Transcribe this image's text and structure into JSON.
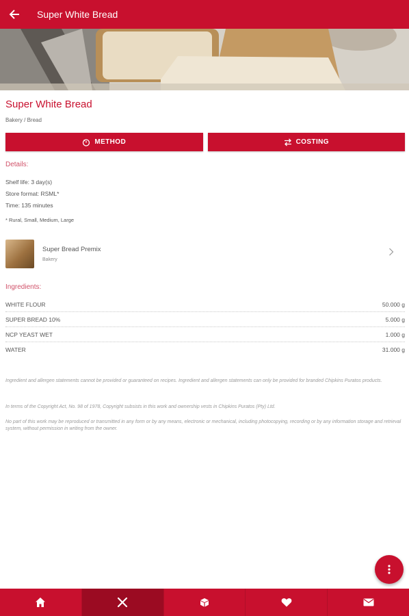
{
  "app_bar": {
    "title": "Super White Bread",
    "back_icon": "arrow-left-icon"
  },
  "recipe": {
    "title": "Super White Bread",
    "category": "Bakery / Bread"
  },
  "actions": {
    "method_label": "METHOD",
    "method_icon": "timer-icon",
    "costing_label": "COSTING",
    "costing_icon": "swap-arrows-icon"
  },
  "details": {
    "label": "Details:",
    "shelf_life": "Shelf life: 3 day(s)",
    "store_format": "Store format: RSML*",
    "time": "Time: 135 minutes",
    "footnote": "* Rural, Small, Medium, Large"
  },
  "premix": {
    "name": "Super Bread Premix",
    "subtitle": "Bakery",
    "chevron_icon": "chevron-right-icon"
  },
  "ingredients": {
    "label": "Ingredients:",
    "rows": [
      {
        "name": "WHITE FLOUR",
        "amount": "50.000 g"
      },
      {
        "name": "SUPER BREAD 10%",
        "amount": "5.000 g"
      },
      {
        "name": "NCP YEAST WET",
        "amount": "1.000 g"
      },
      {
        "name": "WATER",
        "amount": "31.000 g"
      }
    ]
  },
  "legal": {
    "disclaimer": "Ingredient and allergen statements cannot be provided or guaranteed on recipes. Ingredient and allergen statements can only be provided for branded Chipkins Puratos products.",
    "copyright": "In terms of the Copyright Act, No. 98 of 1978, Copyright subsists in this work and ownership vests in Chipkins Puratos (Pty) Ltd.",
    "rights": "No part of this work may be reproduced or transmitted in any form or by any means, electronic or mechanical, including photocopying, recording or by any information storage and retrieval system, without permission in writing from the owner."
  },
  "fab": {
    "icon": "more-vert-icon"
  },
  "bottom_nav": {
    "items": [
      {
        "icon": "home-icon",
        "active": false
      },
      {
        "icon": "utensils-icon",
        "active": true
      },
      {
        "icon": "box-icon",
        "active": false
      },
      {
        "icon": "heart-icon",
        "active": false
      },
      {
        "icon": "mail-icon",
        "active": false
      }
    ]
  },
  "colors": {
    "brand_red": "#c8102e",
    "active_nav": "#9b0b22",
    "section_label": "#d05068"
  }
}
